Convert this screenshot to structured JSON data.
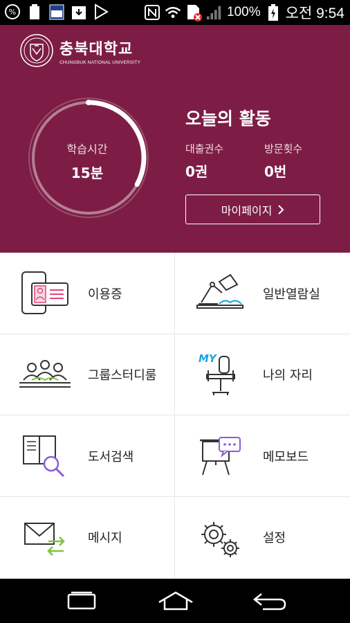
{
  "status_bar": {
    "battery_percent": "100%",
    "time": "오전 9:54"
  },
  "header": {
    "logo_korean": "충북대학교",
    "logo_english": "CHUNGBUK NATIONAL UNIVERSITY"
  },
  "study": {
    "label": "학습시간",
    "value": "15분",
    "progress_fraction": 0.33
  },
  "activity": {
    "title": "오늘의 활동",
    "loans_label": "대출권수",
    "loans_value": "0권",
    "visits_label": "방문횟수",
    "visits_value": "0번",
    "mypage_label": "마이페이지"
  },
  "menu": [
    {
      "label": "이용증",
      "icon": "id-card-icon"
    },
    {
      "label": "일반열람실",
      "icon": "reading-lamp-icon"
    },
    {
      "label": "그룹스터디룸",
      "icon": "group-study-icon"
    },
    {
      "label": "나의 자리",
      "icon": "my-seat-icon",
      "icon_text": "MY"
    },
    {
      "label": "도서검색",
      "icon": "book-search-icon"
    },
    {
      "label": "메모보드",
      "icon": "memo-board-icon"
    },
    {
      "label": "메시지",
      "icon": "message-icon"
    },
    {
      "label": "설정",
      "icon": "settings-icon"
    }
  ],
  "colors": {
    "brand": "#7d1d45",
    "accent_pink": "#e0457b",
    "accent_blue": "#1aa3e0",
    "accent_green": "#7cc443",
    "accent_purple": "#8a5cd6"
  }
}
